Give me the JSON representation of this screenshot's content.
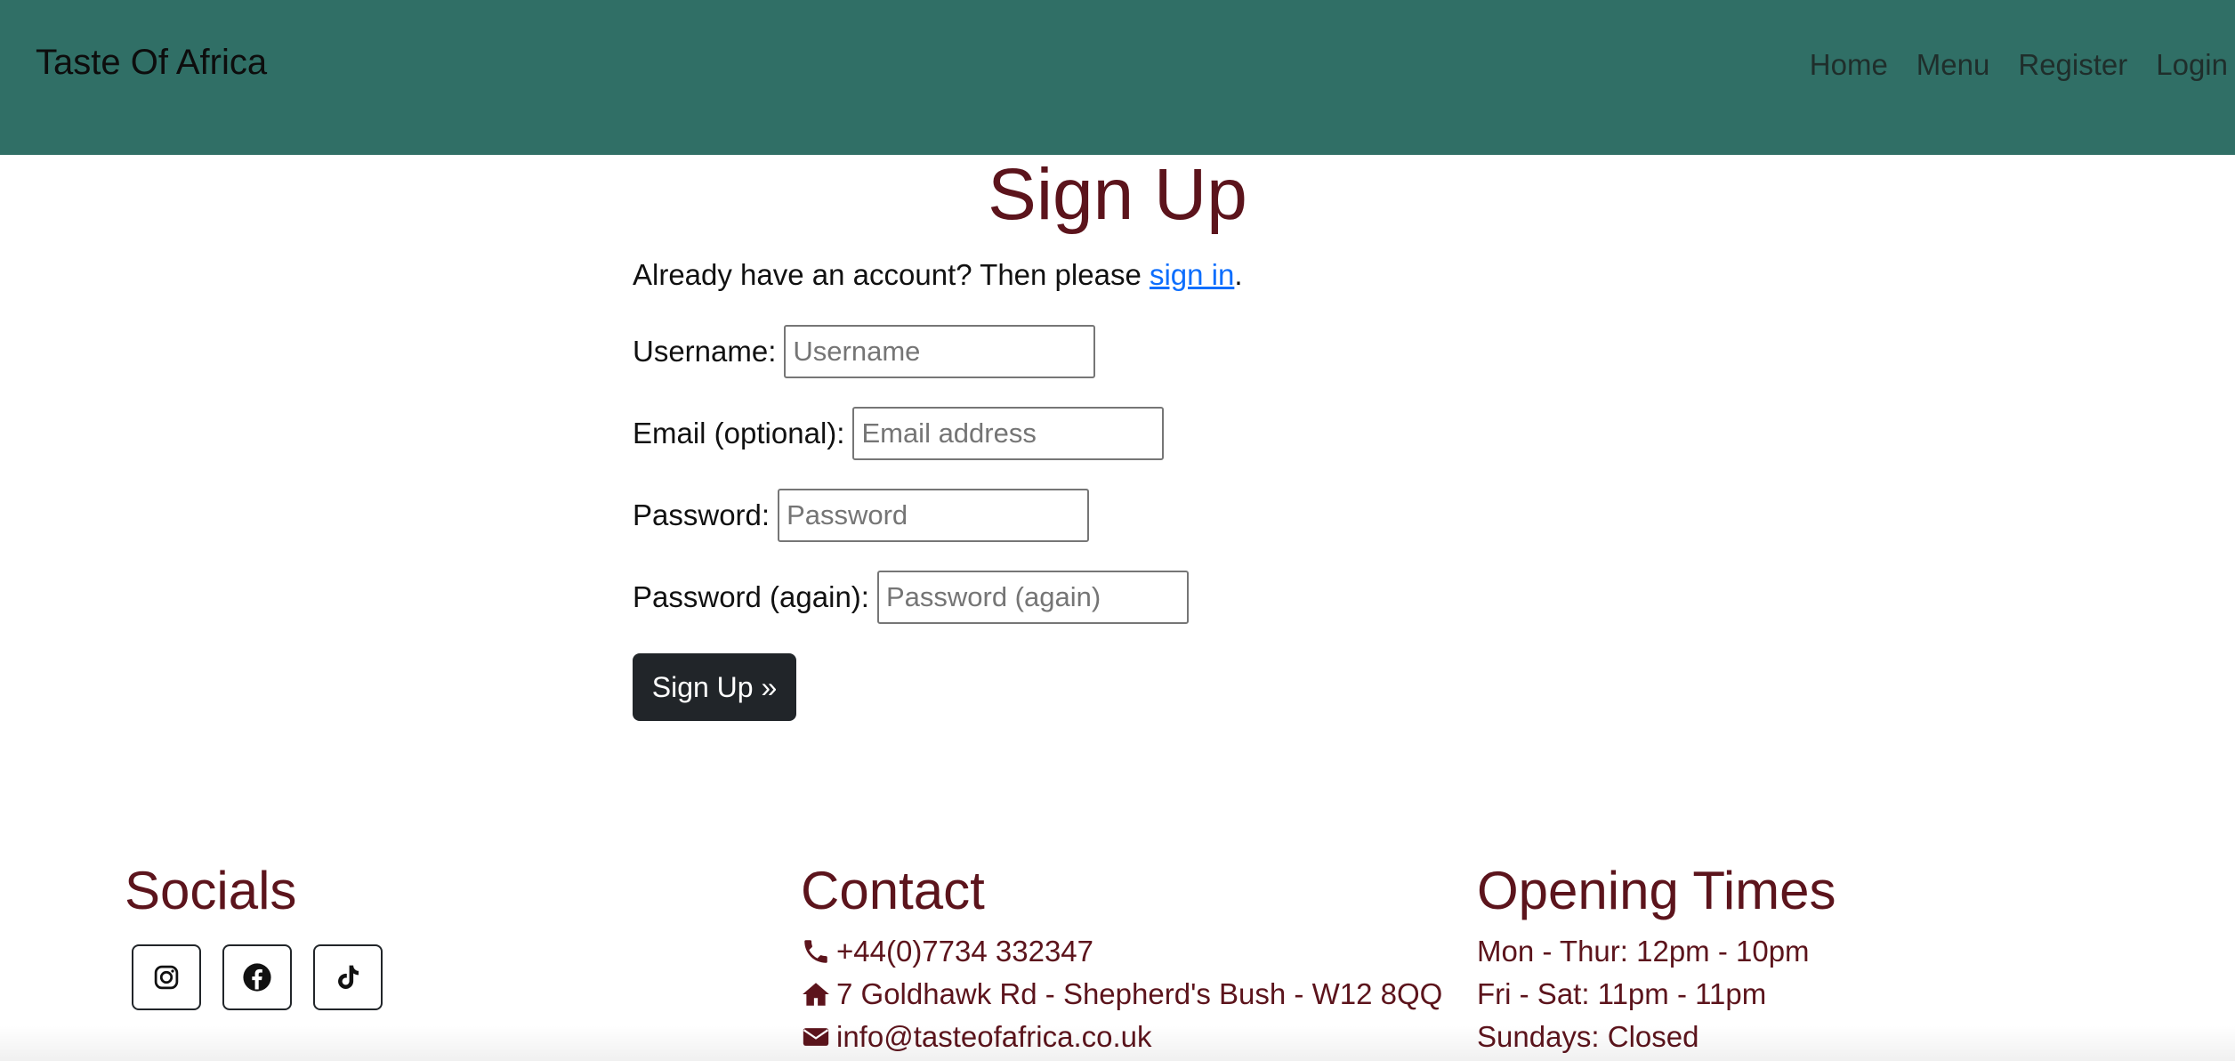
{
  "navbar": {
    "brand": "Taste Of Africa",
    "links": [
      "Home",
      "Menu",
      "Register",
      "Login"
    ]
  },
  "main": {
    "title": "Sign Up",
    "intro_text": "Already have an account? Then please ",
    "intro_link": "sign in",
    "intro_end": ".",
    "fields": [
      {
        "label": "Username:",
        "placeholder": "Username",
        "value": ""
      },
      {
        "label": "Email (optional):",
        "placeholder": "Email address",
        "value": ""
      },
      {
        "label": "Password:",
        "placeholder": "Password",
        "value": ""
      },
      {
        "label": "Password (again):",
        "placeholder": "Password (again)",
        "value": ""
      }
    ],
    "submit_label": "Sign Up »"
  },
  "footer": {
    "socials_heading": "Socials",
    "social_icons": [
      "instagram-icon",
      "facebook-icon",
      "tiktok-icon"
    ],
    "contact_heading": "Contact",
    "contact": [
      {
        "icon": "phone-icon",
        "text": "+44(0)7734 332347"
      },
      {
        "icon": "home-icon",
        "text": "7 Goldhawk Rd - Shepherd's Bush - W12 8QQ"
      },
      {
        "icon": "envelope-icon",
        "text": "info@tasteofafrica.co.uk"
      }
    ],
    "times_heading": "Opening Times",
    "times": [
      "Mon - Thur: 12pm - 10pm",
      "Fri - Sat: 11pm - 11pm",
      "Sundays: Closed"
    ]
  },
  "colors": {
    "navbar_bg": "#306f66",
    "heading": "#5c141c",
    "link": "#0d6efd",
    "button_bg": "#212529"
  }
}
